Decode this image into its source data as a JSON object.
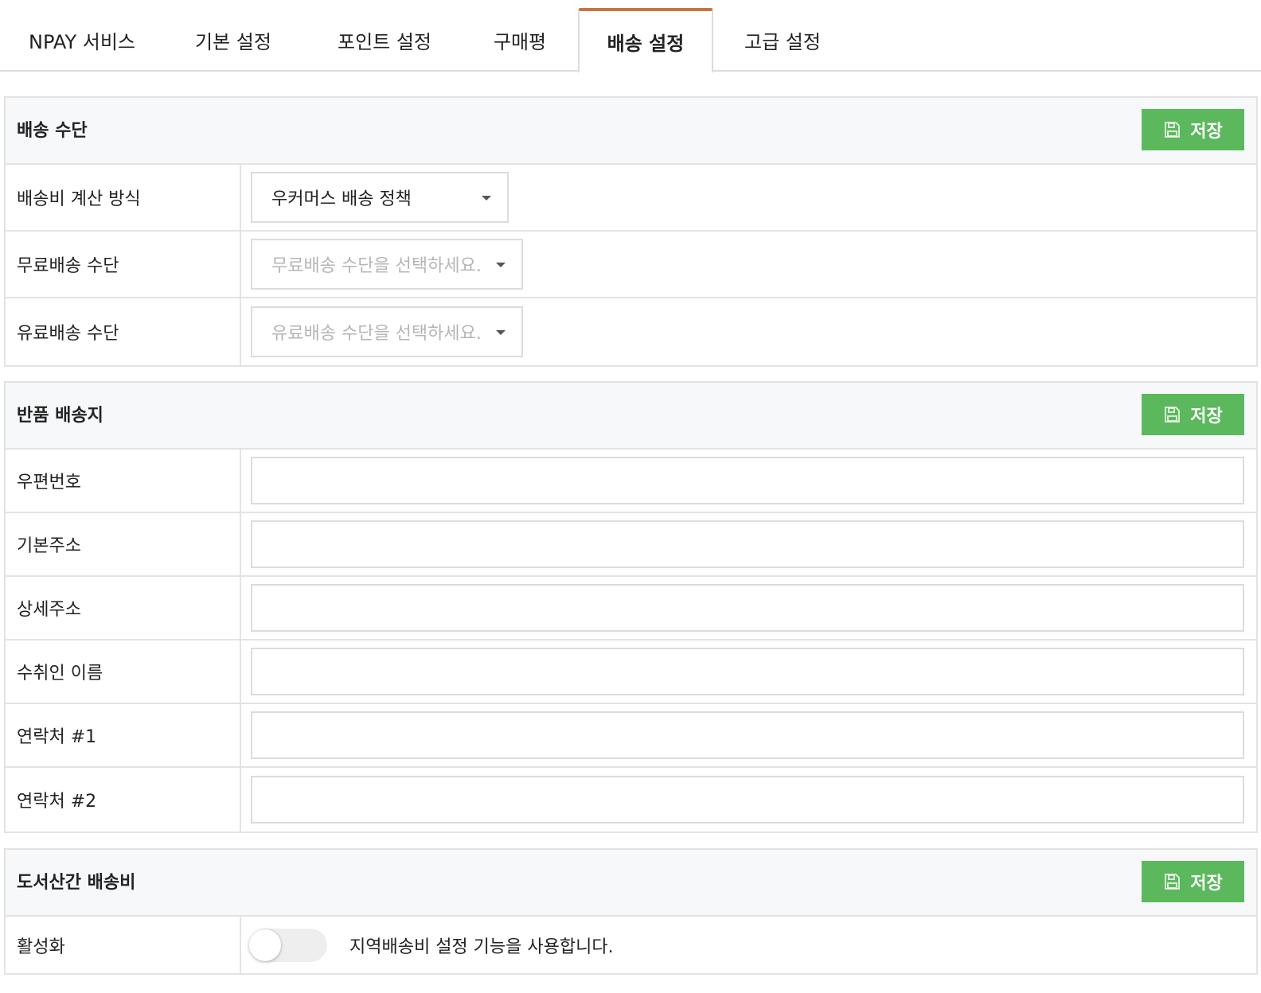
{
  "tabs": [
    {
      "label": "NPAY 서비스"
    },
    {
      "label": "기본 설정"
    },
    {
      "label": "포인트 설정"
    },
    {
      "label": "구매평"
    },
    {
      "label": "배송 설정",
      "active": true
    },
    {
      "label": "고급 설정"
    }
  ],
  "colors": {
    "accent_tab": "#c8743c",
    "save_button": "#5cb85c"
  },
  "save_label": "저장",
  "shipping_method": {
    "title": "배송 수단",
    "rows": [
      {
        "label": "배송비 계산 방식",
        "value": "우커머스 배송 정책"
      },
      {
        "label": "무료배송 수단",
        "placeholder": "무료배송 수단을 선택하세요."
      },
      {
        "label": "유료배송 수단",
        "placeholder": "유료배송 수단을 선택하세요."
      }
    ]
  },
  "return_address": {
    "title": "반품 배송지",
    "rows": [
      {
        "label": "우편번호"
      },
      {
        "label": "기본주소"
      },
      {
        "label": "상세주소"
      },
      {
        "label": "수취인 이름"
      },
      {
        "label": "연락처 #1"
      },
      {
        "label": "연락처 #2"
      }
    ]
  },
  "island_fee": {
    "title": "도서산간 배송비",
    "rows": [
      {
        "label": "활성화",
        "toggle_on": false,
        "description": "지역배송비 설정 기능을 사용합니다."
      }
    ]
  }
}
